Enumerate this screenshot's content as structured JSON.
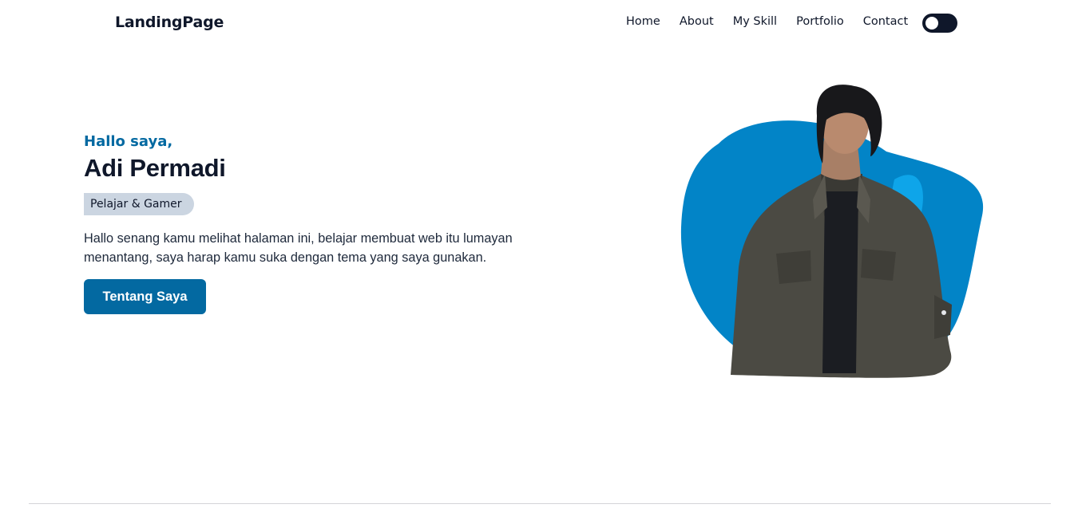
{
  "navbar": {
    "brand": "LandingPage",
    "links": [
      {
        "label": "Home"
      },
      {
        "label": "About"
      },
      {
        "label": "My Skill"
      },
      {
        "label": "Portfolio"
      },
      {
        "label": "Contact"
      }
    ],
    "dark_mode_toggle": {
      "state": "off"
    }
  },
  "hero": {
    "greeting": "Hallo saya,",
    "name": "Adi Permadi",
    "role": "Pelajar & Gamer",
    "description": "Hallo senang kamu melihat halaman ini, belajar membuat web itu lumayan menantang, saya harap kamu suka dengan tema yang saya gunakan.",
    "cta_label": "Tentang Saya"
  },
  "colors": {
    "primary": "#0369a1",
    "blob": "#0284c7",
    "blob_highlight": "#0ea5e9",
    "dark": "#0f172a",
    "badge": "#cbd5e1"
  }
}
